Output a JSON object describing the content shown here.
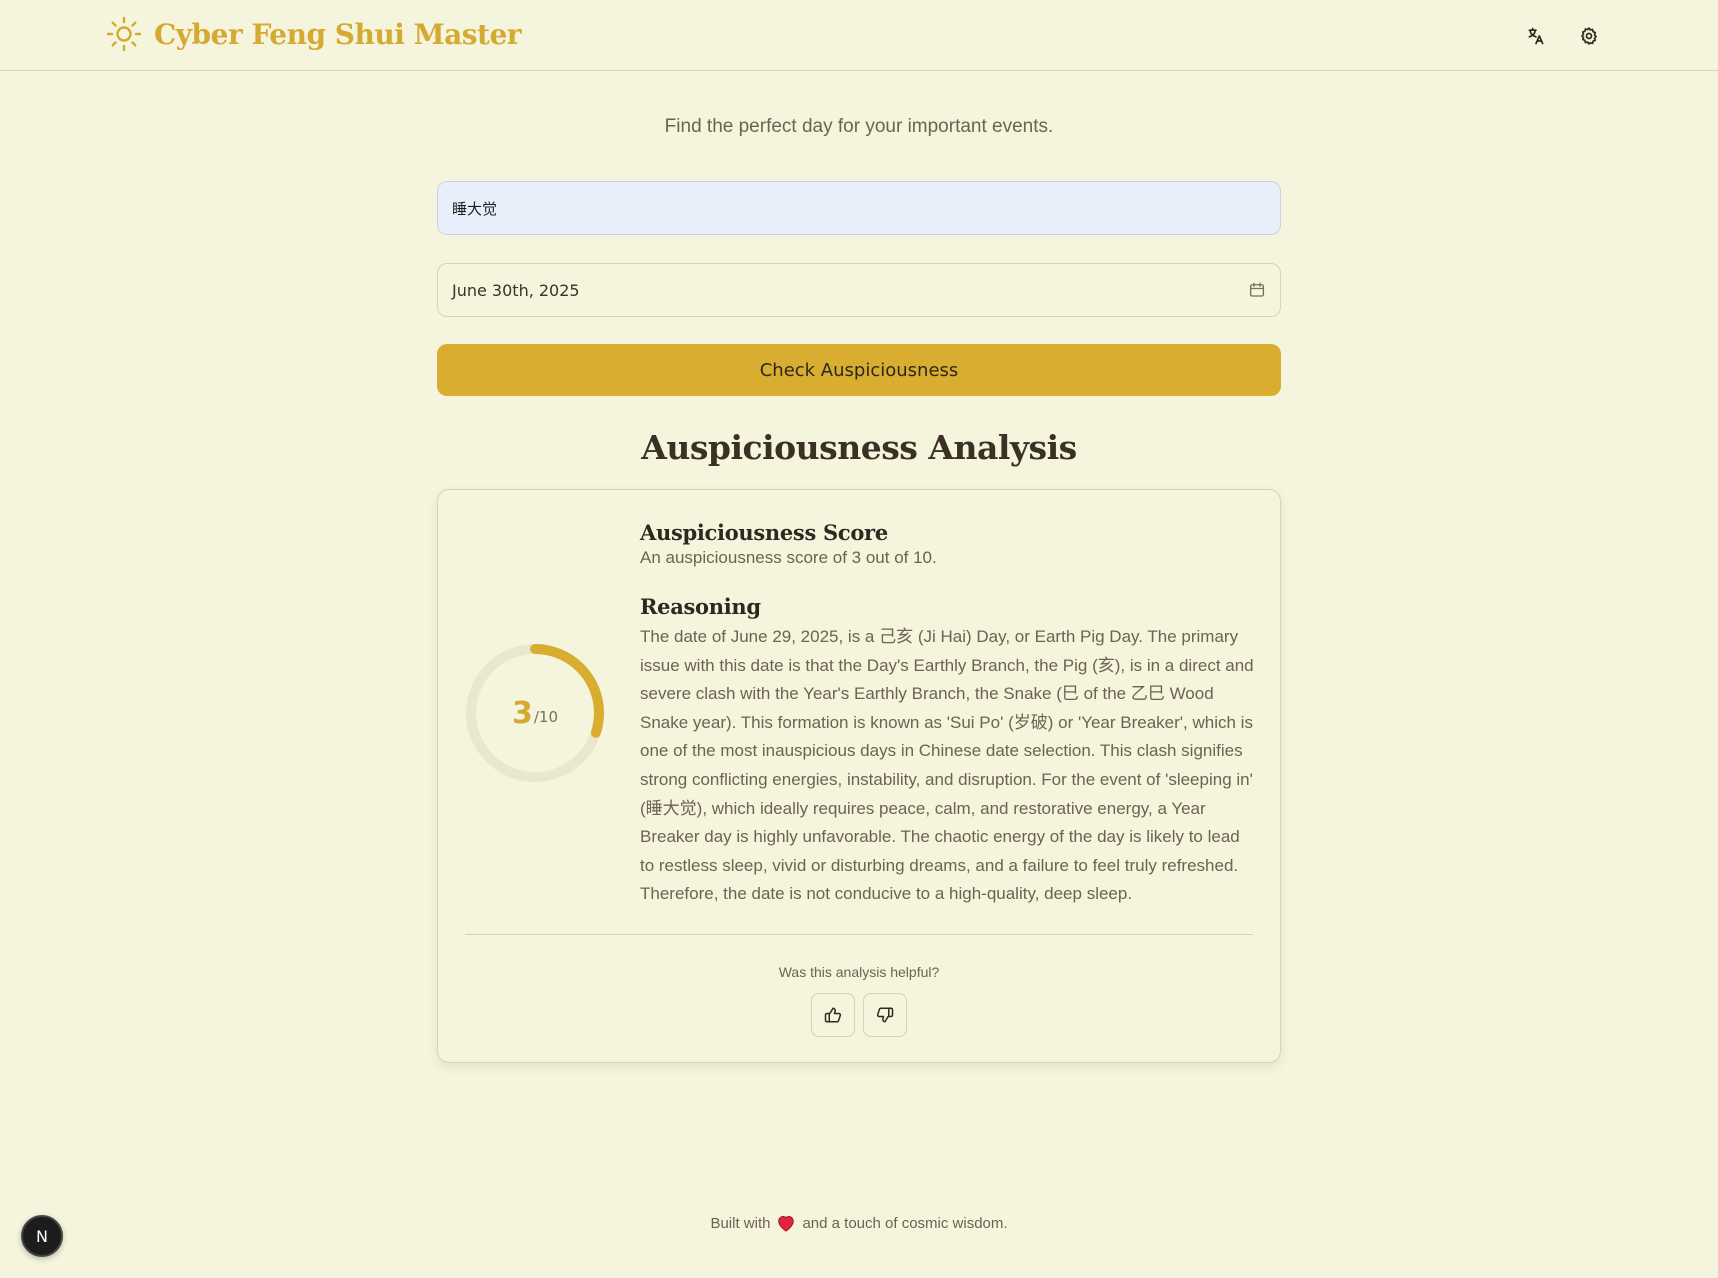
{
  "header": {
    "title": "Cyber Feng Shui Master",
    "logo_icon": "sun-icon",
    "accent_color": "#d4aa32",
    "actions": [
      {
        "name": "language-button",
        "icon": "translate-icon"
      },
      {
        "name": "settings-button",
        "icon": "gear-icon"
      }
    ]
  },
  "main": {
    "subtitle": "Find the perfect day for your important events.",
    "event_input": {
      "value": "睡大觉",
      "placeholder": ""
    },
    "date_picker": {
      "value": "June 30th, 2025",
      "icon": "calendar-icon"
    },
    "check_button_label": "Check Auspiciousness",
    "analysis_title": "Auspiciousness Analysis"
  },
  "result": {
    "score": "3",
    "score_max": "/10",
    "score_fraction": 0.3,
    "score_heading": "Auspiciousness Score",
    "score_text": "An auspiciousness score of 3 out of 10.",
    "reasoning_heading": "Reasoning",
    "reasoning_text": "The date of June 29, 2025, is a 己亥 (Ji Hai) Day, or Earth Pig Day. The primary issue with this date is that the Day's Earthly Branch, the Pig (亥), is in a direct and severe clash with the Year's Earthly Branch, the Snake (巳 of the 乙巳 Wood Snake year). This formation is known as 'Sui Po' (岁破) or 'Year Breaker', which is one of the most inauspicious days in Chinese date selection. This clash signifies strong conflicting energies, instability, and disruption. For the event of 'sleeping in' (睡大觉), which ideally requires peace, calm, and restorative energy, a Year Breaker day is highly unfavorable. The chaotic energy of the day is likely to lead to restless sleep, vivid or disturbing dreams, and a failure to feel truly refreshed. Therefore, the date is not conducive to a high-quality, deep sleep.",
    "feedback_prompt": "Was this analysis helpful?",
    "feedback_buttons": [
      {
        "name": "thumbs-up-button",
        "icon": "thumbs-up-icon"
      },
      {
        "name": "thumbs-down-button",
        "icon": "thumbs-down-icon"
      }
    ]
  },
  "footer": {
    "text_before": "Built with",
    "heart_icon": "heart-icon",
    "text_after": "and a touch of cosmic wisdom."
  },
  "dev_badge": {
    "label": "N"
  }
}
